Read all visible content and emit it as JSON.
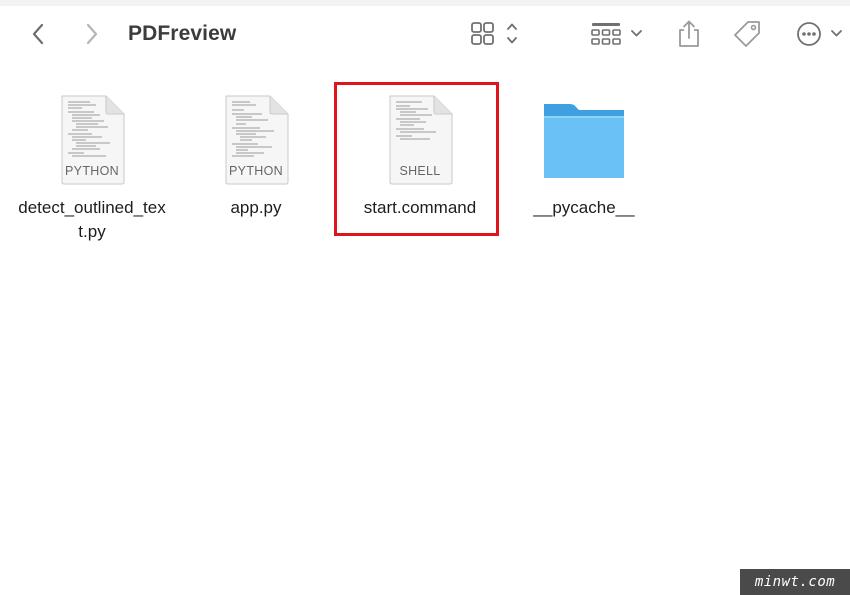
{
  "window": {
    "title": "PDFreview"
  },
  "toolbar": {
    "back_icon": "chevron-left-icon",
    "forward_icon": "chevron-right-icon",
    "view_icon": "grid-view-icon",
    "group_icon": "group-by-icon",
    "share_icon": "share-icon",
    "tag_icon": "tag-icon",
    "more_icon": "ellipsis-circle-icon"
  },
  "files": [
    {
      "name": "detect_outlined_text.py",
      "kind_label": "PYTHON",
      "type": "document"
    },
    {
      "name": "app.py",
      "kind_label": "PYTHON",
      "type": "document"
    },
    {
      "name": "start.command",
      "kind_label": "SHELL",
      "type": "document",
      "highlighted": true
    },
    {
      "name": "__pycache__",
      "type": "folder"
    }
  ],
  "colors": {
    "folder": "#5ab4ec",
    "highlight": "#e0141c",
    "icon_gray": "#707070"
  },
  "watermark": {
    "text": "minwt.com"
  }
}
